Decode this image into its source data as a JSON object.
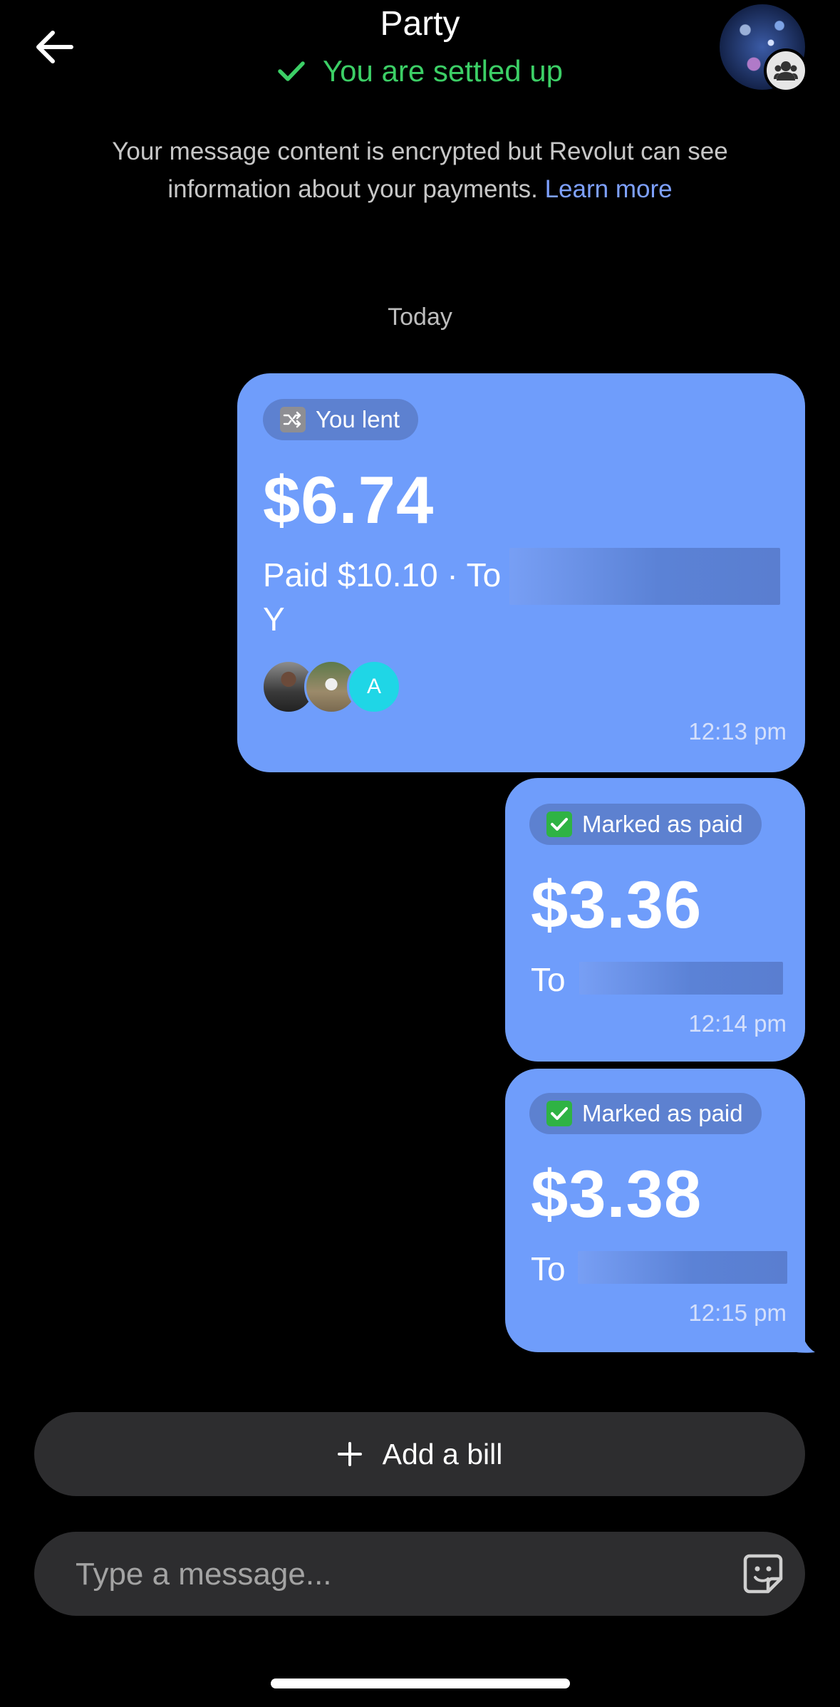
{
  "header": {
    "title": "Party",
    "status": "You are settled up",
    "status_color": "#3ccf66"
  },
  "notice": {
    "text": "Your message content is encrypted but Revolut can see information about your payments.",
    "link": "Learn more"
  },
  "day_label": "Today",
  "messages": [
    {
      "tag": "You lent",
      "tag_icon": "shuffle-icon",
      "amount": "$6.74",
      "detail": "Paid $10.10 · To",
      "detail_cont": "Y",
      "participant_initial": "A",
      "time": "12:13 pm"
    },
    {
      "tag": "Marked as paid",
      "tag_icon": "check-emoji-icon",
      "amount": "$3.36",
      "detail": "To",
      "time": "12:14 pm"
    },
    {
      "tag": "Marked as paid",
      "tag_icon": "check-emoji-icon",
      "amount": "$3.38",
      "detail": "To",
      "time": "12:15 pm"
    }
  ],
  "actions": {
    "add_bill": "Add a bill",
    "message_placeholder": "Type a message..."
  },
  "colors": {
    "bubble": "#6f9dfb",
    "link": "#7ea1ff",
    "input_bg": "#2d2d2f"
  }
}
